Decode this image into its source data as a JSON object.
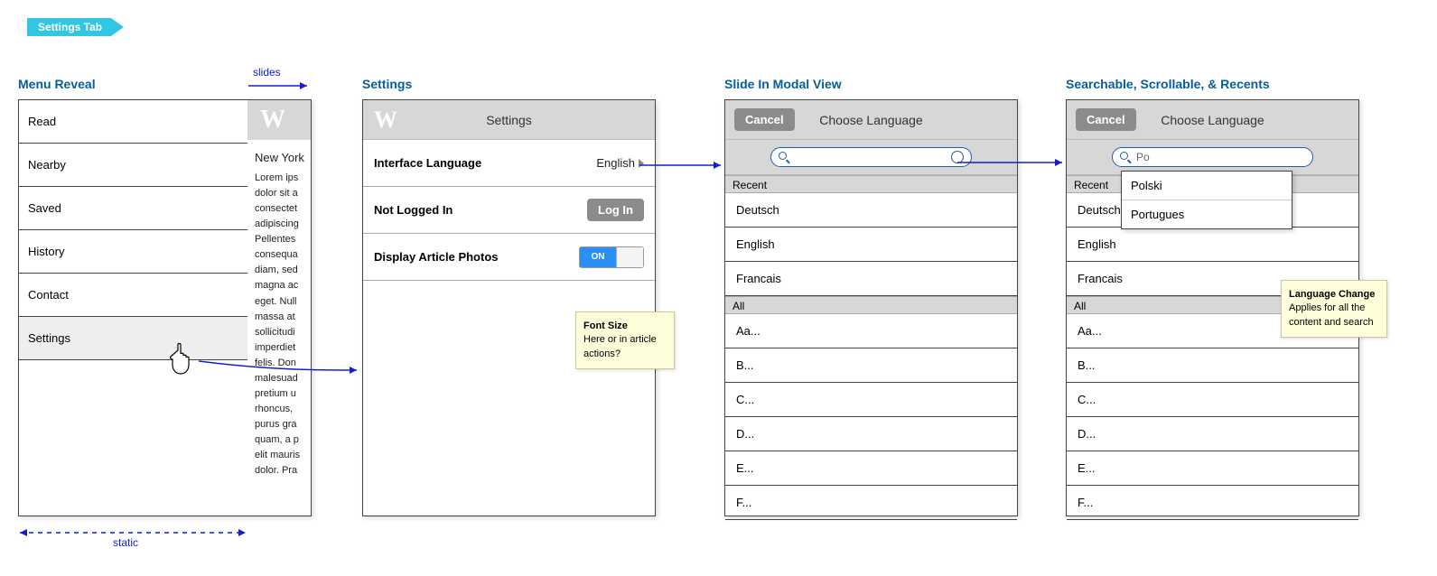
{
  "ribbon": "Settings Tab",
  "sections": {
    "menuReveal": "Menu Reveal",
    "settings": "Settings",
    "slideIn": "Slide In Modal View",
    "searchable": "Searchable, Scrollable, & Recents"
  },
  "annotations": {
    "slides": "slides",
    "static": "static"
  },
  "logo": "W",
  "menu": {
    "items": [
      "Read",
      "Nearby",
      "Saved",
      "History",
      "Contact",
      "Settings"
    ],
    "selectedIndex": 5
  },
  "articleSliver": {
    "title": "New York",
    "lines": [
      "Lorem ips",
      "dolor sit a",
      "consectet",
      "adipiscing",
      "Pellentes",
      "consequa",
      "diam, sed",
      "magna ac",
      "eget. Null",
      "massa at",
      "sollicitudi",
      "imperdiet",
      "felis. Don",
      "malesuad",
      "pretium u",
      "rhoncus,",
      "purus gra",
      "quam, a p",
      "elit mauris",
      "dolor. Pra"
    ]
  },
  "settingsScreen": {
    "title": "Settings",
    "rows": {
      "language": {
        "label": "Interface Language",
        "value": "English"
      },
      "login": {
        "label": "Not Logged In",
        "button": "Log In"
      },
      "photos": {
        "label": "Display Article Photos",
        "toggle": "ON"
      }
    }
  },
  "langScreen": {
    "cancel": "Cancel",
    "title": "Choose Language",
    "searchValue": "",
    "recentHeader": "Recent",
    "recent": [
      "Deutsch",
      "English",
      "Francais"
    ],
    "allHeader": "All",
    "all": [
      "Aa...",
      "B...",
      "C...",
      "D...",
      "E...",
      "F..."
    ]
  },
  "langScreen2": {
    "cancel": "Cancel",
    "title": "Choose Language",
    "searchValue": "Po",
    "suggestions": [
      "Polski",
      "Portugues"
    ],
    "recentHeader": "Recent",
    "recent": [
      "Deutsch",
      "English",
      "Francais"
    ],
    "allHeader": "All",
    "all": [
      "Aa...",
      "B...",
      "C...",
      "D...",
      "E...",
      "F..."
    ]
  },
  "stickies": {
    "fontSize": {
      "head": "Font Size",
      "body": "Here or in article actions?"
    },
    "langChange": {
      "head": "Language Change",
      "body": "Applies for all the content and search"
    }
  }
}
